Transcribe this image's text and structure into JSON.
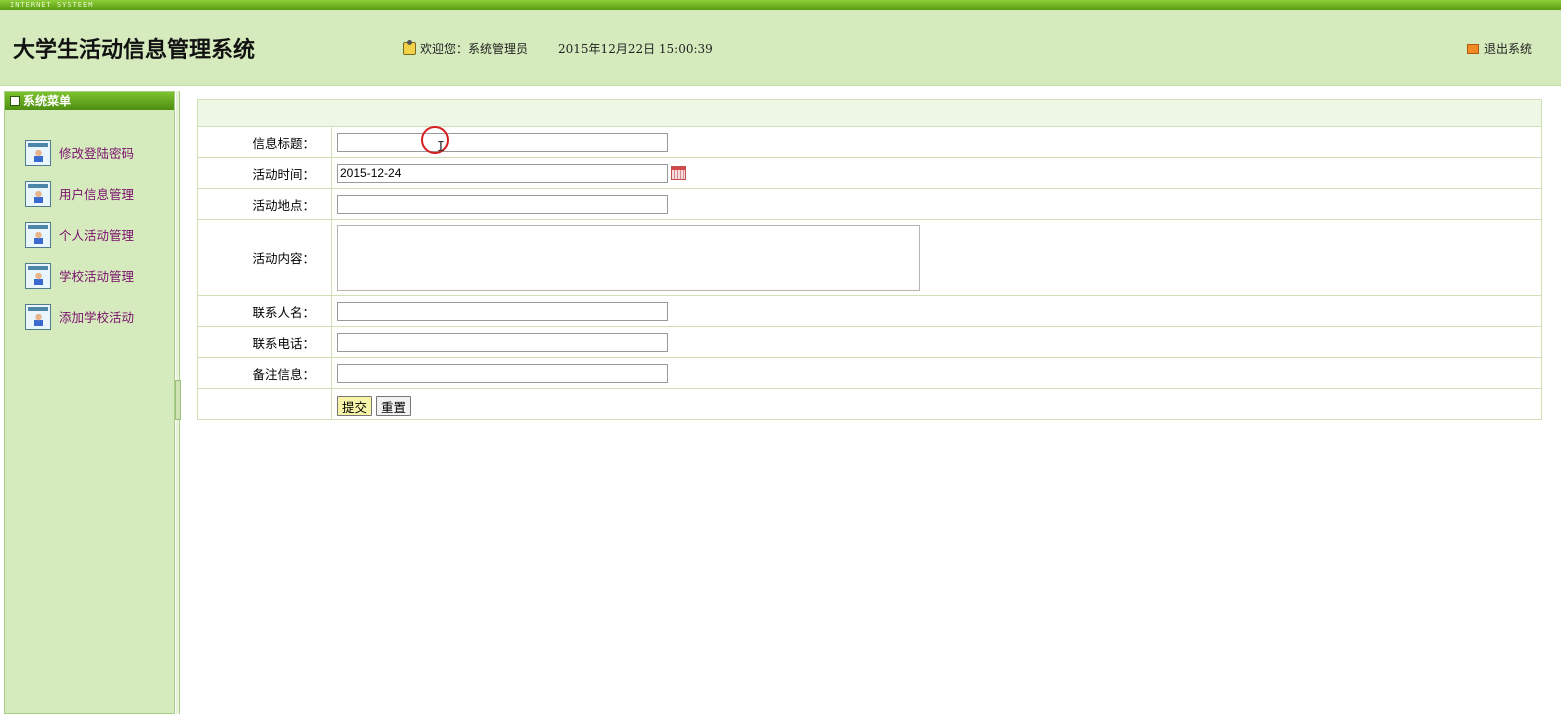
{
  "topstrip": {
    "text": "INTERNET SYSTEEM"
  },
  "header": {
    "title": "大学生活动信息管理系统",
    "welcome": "欢迎您：系统管理员",
    "datetime": "2015年12月22日  15:00:39",
    "logout_label": "退出系统",
    "icons": {
      "user": "user-lock-icon",
      "logout": "logout-arrow-icon"
    }
  },
  "sidebar": {
    "title": "系统菜单",
    "items": [
      {
        "label": "修改登陆密码"
      },
      {
        "label": "用户信息管理"
      },
      {
        "label": "个人活动管理"
      },
      {
        "label": "学校活动管理"
      },
      {
        "label": "添加学校活动"
      }
    ]
  },
  "form": {
    "title_label": "信息标题：",
    "title_value": "",
    "time_label": "活动时间：",
    "time_value": "2015-12-24",
    "place_label": "活动地点：",
    "place_value": "",
    "content_label": "活动内容：",
    "content_value": "",
    "contact_label": "联系人名：",
    "contact_value": "",
    "phone_label": "联系电话：",
    "phone_value": "",
    "remark_label": "备注信息：",
    "remark_value": "",
    "submit_label": "提交",
    "reset_label": "重置"
  },
  "colors": {
    "header_bg": "#d6ebbd",
    "sidebar_head": "#5fa11a",
    "menu_text": "#7a0f6e",
    "submit_bg": "#f7f3a8"
  }
}
